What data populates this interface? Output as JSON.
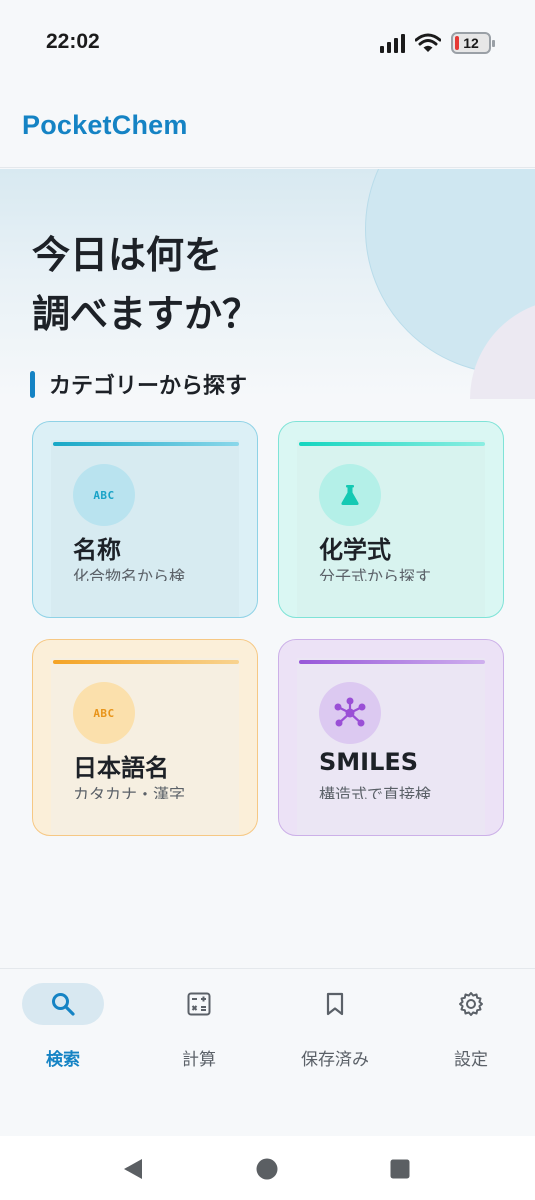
{
  "status_bar": {
    "time": "22:02",
    "battery_level": "12"
  },
  "app": {
    "title": "PocketChem",
    "brand_color": "#1583c4"
  },
  "hero": {
    "line1": "今日は何を",
    "line2": "調べますか？"
  },
  "section": {
    "heading": "カテゴリーから探す"
  },
  "categories": [
    {
      "title": "名称",
      "subtitle": "化合物名から検",
      "icon": "abc-icon",
      "icon_text": "ABC",
      "accent": "#17a7c6"
    },
    {
      "title": "化学式",
      "subtitle": "分子式から探す",
      "icon": "flask-icon",
      "accent": "#14d5bf"
    },
    {
      "title": "日本語名",
      "subtitle": "カタカナ・漢字",
      "icon": "abc-icon",
      "icon_text": "ABC",
      "accent": "#f4a325"
    },
    {
      "title": "SMILES",
      "subtitle": "構造式で直接検",
      "icon": "molecule-icon",
      "accent": "#9757d8"
    }
  ],
  "bottom_nav": {
    "items": [
      {
        "label": "検索",
        "icon": "search-icon",
        "active": true
      },
      {
        "label": "計算",
        "icon": "calculator-icon",
        "active": false
      },
      {
        "label": "保存済み",
        "icon": "bookmark-icon",
        "active": false
      },
      {
        "label": "設定",
        "icon": "gear-icon",
        "active": false
      }
    ]
  }
}
